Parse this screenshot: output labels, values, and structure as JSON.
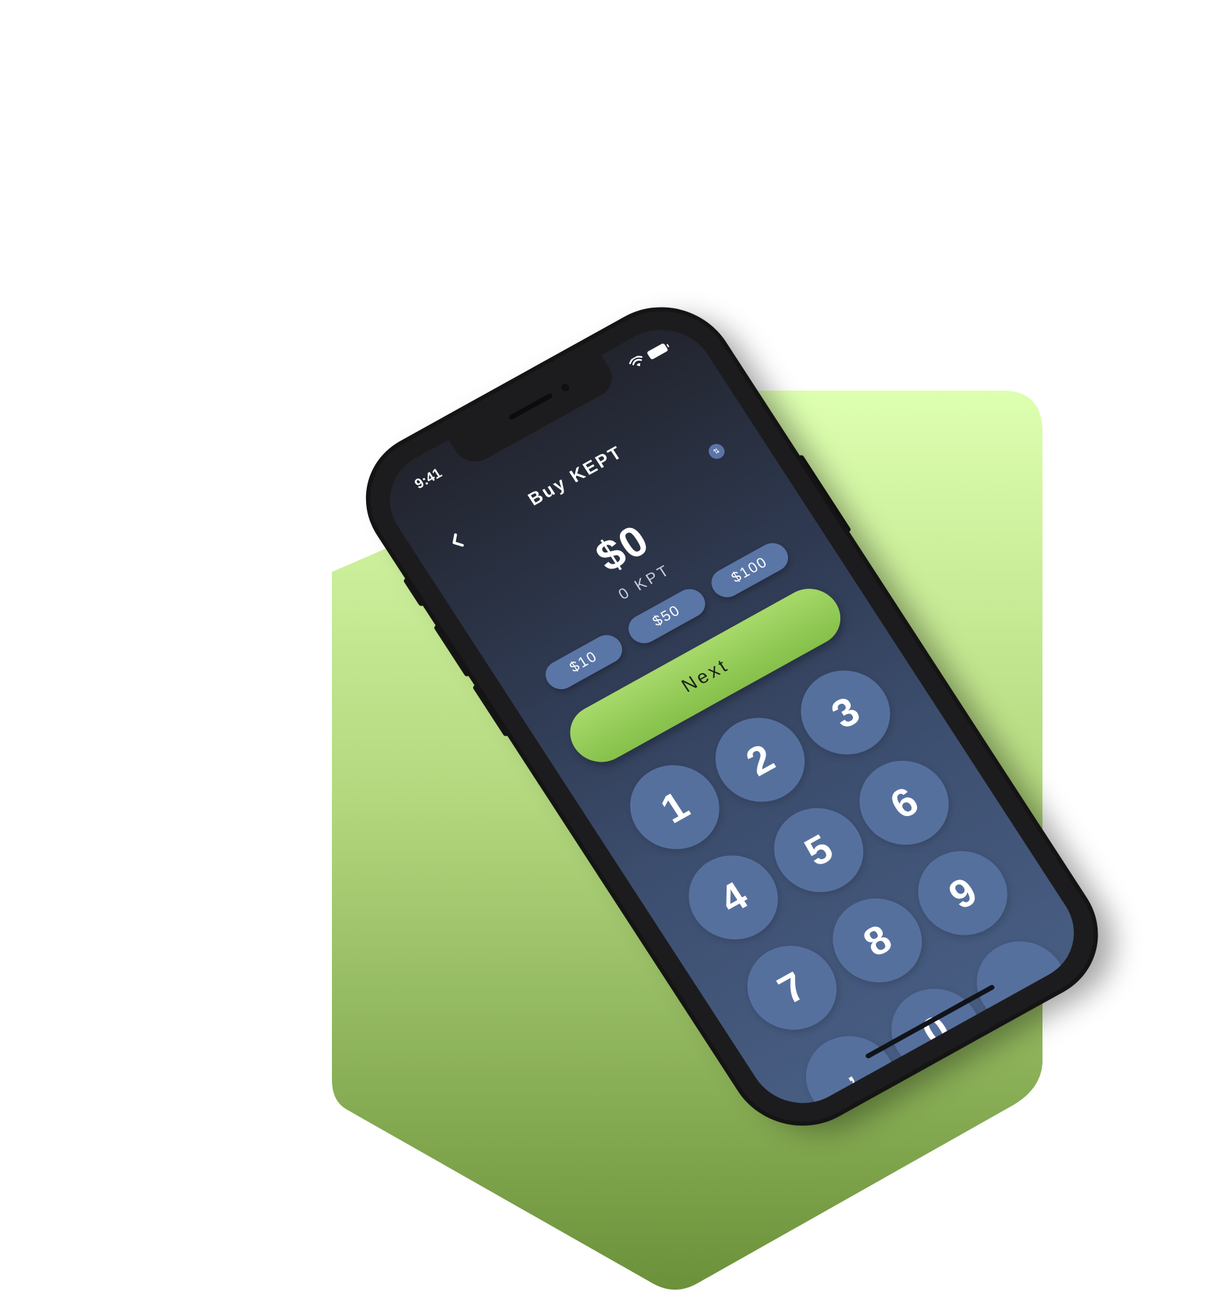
{
  "status_bar": {
    "time": "9:41",
    "wifi_icon": "wifi-icon",
    "battery_icon": "battery-icon"
  },
  "header": {
    "back_icon": "chevron-left-icon",
    "title": "Buy KEPT",
    "swap_icon": "swap-vertical-icon"
  },
  "amount": {
    "fiat": "$0",
    "token": "0 KPT"
  },
  "presets": [
    {
      "label": "$10"
    },
    {
      "label": "$50"
    },
    {
      "label": "$100"
    }
  ],
  "next_button": {
    "label": "Next"
  },
  "keypad": {
    "keys": [
      "1",
      "2",
      "3",
      "4",
      "5",
      "6",
      "7",
      "8",
      "9",
      ",",
      "0",
      ""
    ]
  },
  "colors": {
    "accent_green": "#94cc5a",
    "chip_blue": "#5a76a6",
    "key_blue": "#56709e",
    "screen_top": "#22242d",
    "screen_bottom": "#475d82",
    "backdrop_top": "#ddffb0",
    "backdrop_bottom": "#6b913a"
  }
}
